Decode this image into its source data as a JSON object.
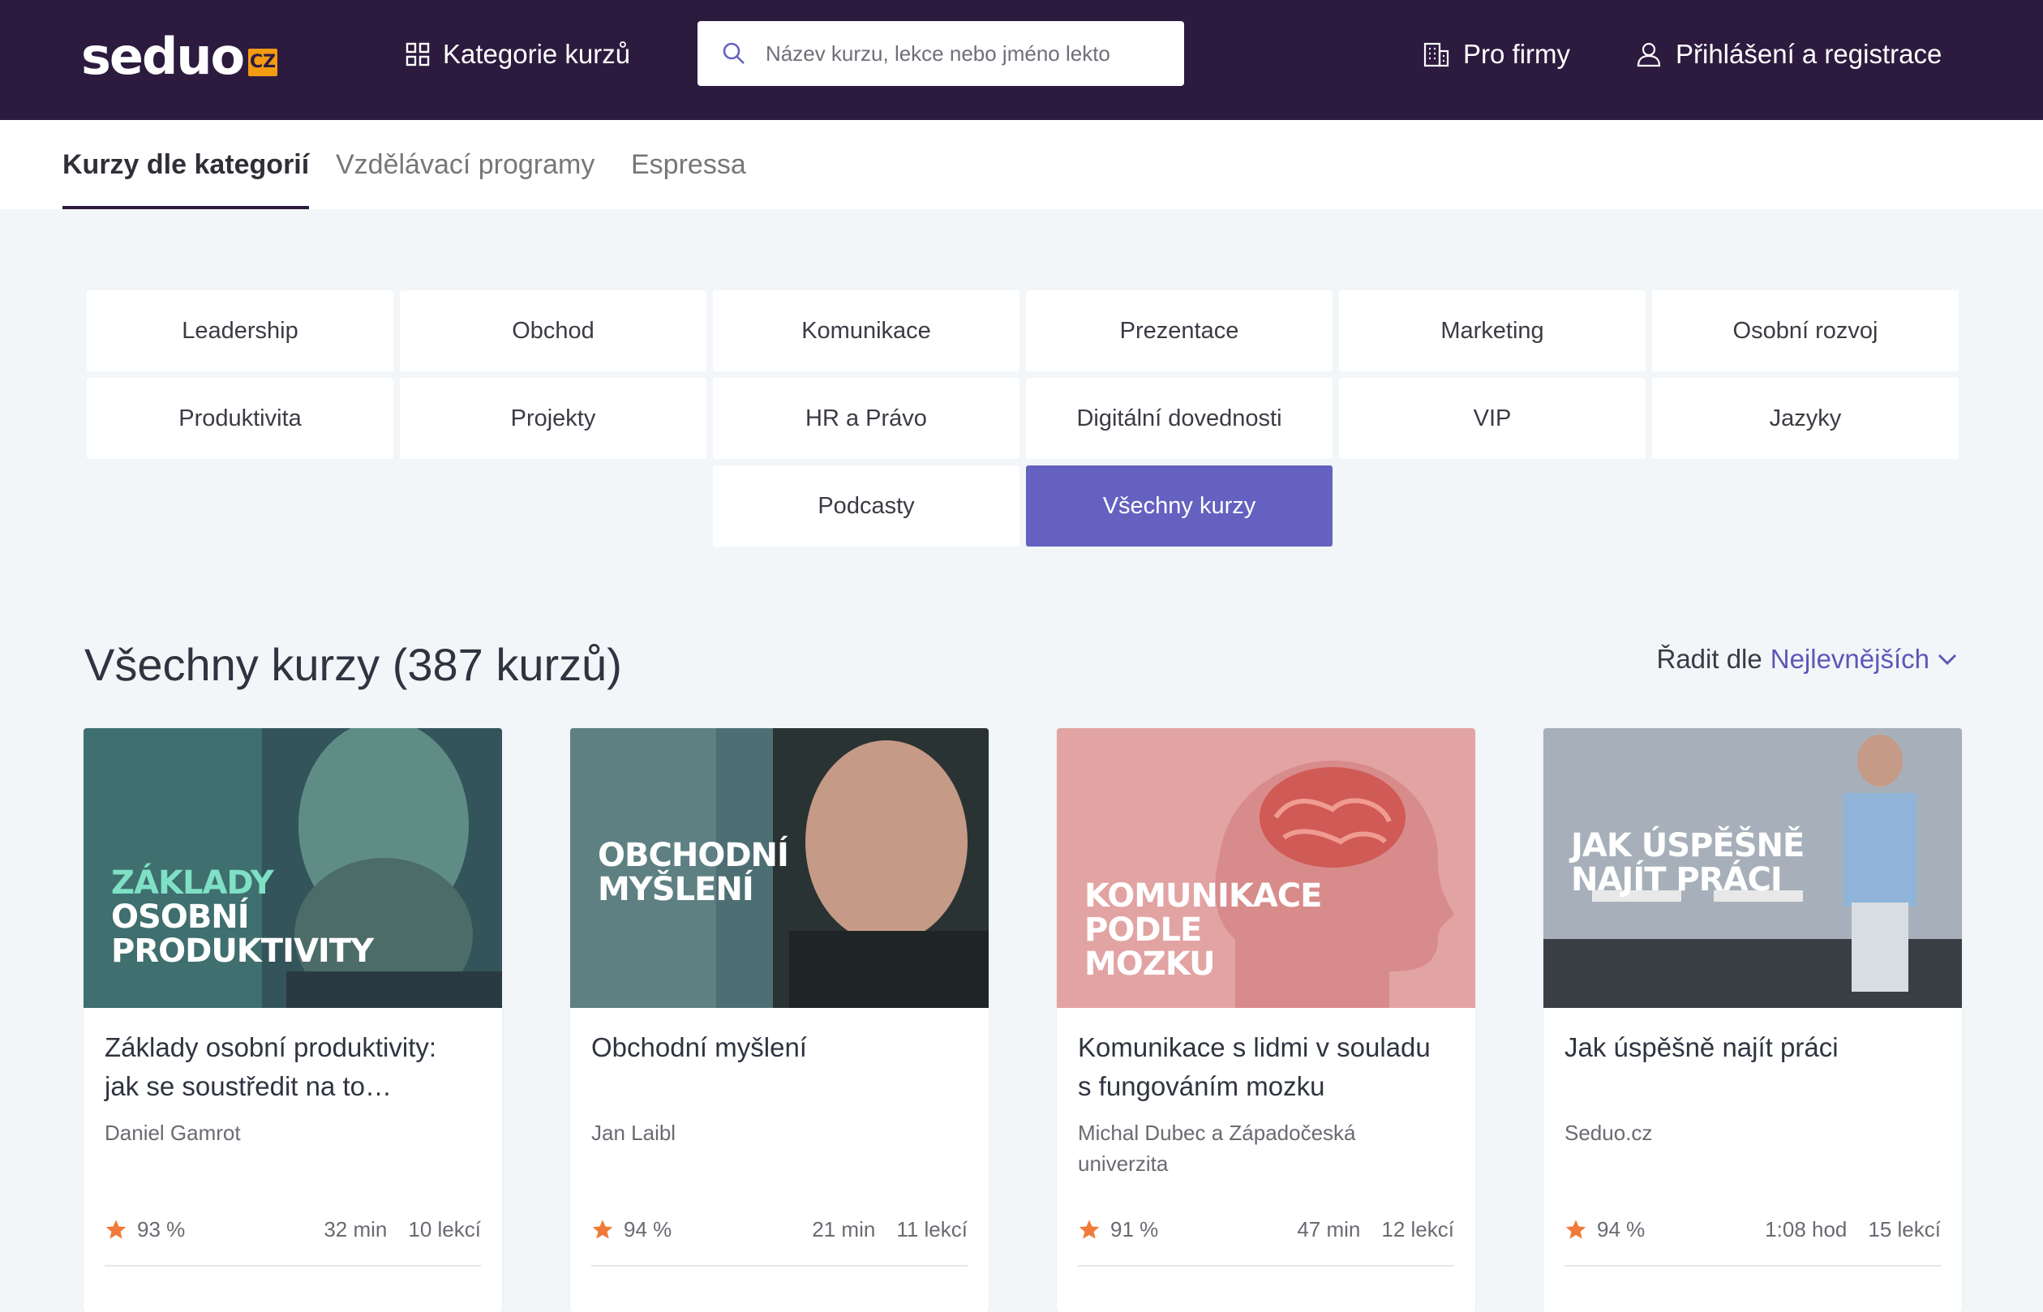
{
  "header": {
    "logo_text": "seduo",
    "logo_badge": "CZ",
    "categories_label": "Kategorie kurzů",
    "search_placeholder": "Název kurzu, lekce nebo jméno lekto",
    "business_label": "Pro firmy",
    "login_label": "Přihlášení a registrace"
  },
  "tabs": [
    {
      "label": "Kurzy dle kategorií",
      "active": true
    },
    {
      "label": "Vzdělávací programy",
      "active": false
    },
    {
      "label": "Espressa",
      "active": false
    }
  ],
  "categories": [
    "Leadership",
    "Obchod",
    "Komunikace",
    "Prezentace",
    "Marketing",
    "Osobní rozvoj",
    "Produktivita",
    "Projekty",
    "HR a Právo",
    "Digitální dovednosti",
    "VIP",
    "Jazyky",
    "Podcasty",
    "Všechny kurzy"
  ],
  "selected_category": "Všechny kurzy",
  "listing": {
    "heading": "Všechny kurzy (387 kurzů)",
    "sort_label": "Řadit dle",
    "sort_value": "Nejlevnějších"
  },
  "courses": [
    {
      "thumb_lines": [
        "ZÁKLADY",
        "OSOBNÍ",
        "PRODUKTIVITY"
      ],
      "title": "Základy osobní produktivity: jak se soustředit na to…",
      "author": "Daniel Gamrot",
      "rating": "93 %",
      "duration": "32 min",
      "lessons": "10 lekcí"
    },
    {
      "thumb_lines": [
        "OBCHODNÍ",
        "MYŠLENÍ"
      ],
      "title": "Obchodní myšlení",
      "author": "Jan Laibl",
      "rating": "94 %",
      "duration": "21 min",
      "lessons": "11 lekcí"
    },
    {
      "thumb_lines": [
        "KOMUNIKACE",
        "PODLE",
        "MOZKU"
      ],
      "title": "Komunikace s lidmi v souladu s fungováním mozku",
      "author": "Michal Dubec a Západočeská univerzita",
      "rating": "91 %",
      "duration": "47 min",
      "lessons": "12 lekcí"
    },
    {
      "thumb_lines": [
        "JAK ÚSPĚŠNĚ",
        "NAJÍT PRÁCI"
      ],
      "title": "Jak úspěšně najít práci",
      "author": "Seduo.cz",
      "rating": "94 %",
      "duration": "1:08 hod",
      "lessons": "15 lekcí"
    }
  ],
  "colors": {
    "header_bg": "#2d1b3f",
    "accent": "#6461c0",
    "badge": "#f39c12",
    "star": "#f07a3a",
    "page_bg": "#f3f6f8"
  },
  "icons": {
    "grid": "grid-icon",
    "search": "search-icon",
    "building": "building-icon",
    "user": "user-icon",
    "chevron": "chevron-down-icon",
    "star": "star-icon"
  }
}
